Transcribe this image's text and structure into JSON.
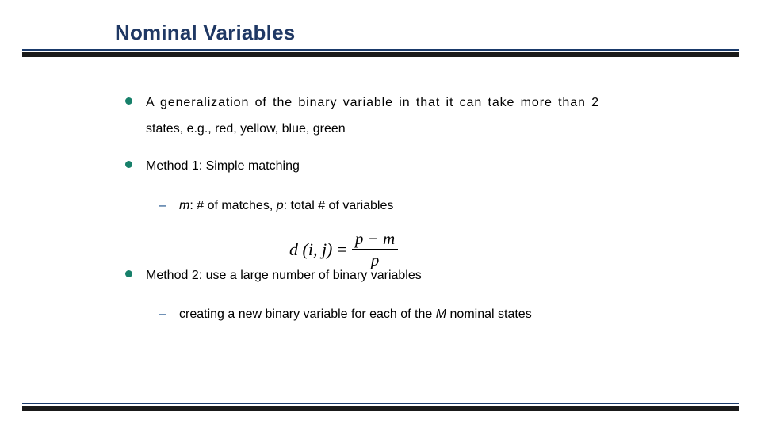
{
  "slide": {
    "title": "Nominal Variables",
    "bullets": [
      {
        "level": 1,
        "marker": "bullet-dot",
        "line1": "A generalization of the binary variable in that it can take more than 2",
        "line2": "states, e.g., red, yellow, blue, green"
      },
      {
        "level": 1,
        "marker": "bullet-dot",
        "text": "Method 1: Simple matching"
      },
      {
        "level": 2,
        "marker": "dash",
        "parts": {
          "m": "m",
          "m_desc": ": # of matches, ",
          "p": "p",
          "p_desc": ": total # of variables"
        }
      },
      {
        "level": 1,
        "marker": "bullet-dot",
        "text": "Method 2: use a large number of binary variables"
      },
      {
        "level": 2,
        "marker": "dash",
        "parts": {
          "pre": "creating a new binary variable for each of the ",
          "var": "M",
          "post": " nominal states"
        }
      }
    ],
    "formula": {
      "lhs": "d (i, j)",
      "equals": "=",
      "numerator": "p − m",
      "denominator": "p"
    }
  }
}
